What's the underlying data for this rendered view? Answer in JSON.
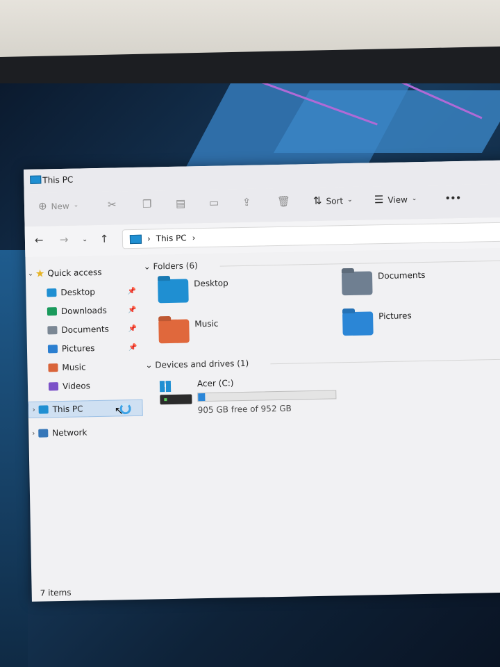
{
  "window": {
    "title": "This PC"
  },
  "toolbar": {
    "new_label": "New",
    "sort_label": "Sort",
    "view_label": "View",
    "more_label": "•••"
  },
  "address": {
    "crumb": "This PC"
  },
  "sidebar": {
    "quick_access": "Quick access",
    "items": [
      {
        "label": "Desktop",
        "color": "#1f8fd2",
        "pinned": true
      },
      {
        "label": "Downloads",
        "color": "#1a9a5c",
        "pinned": true
      },
      {
        "label": "Documents",
        "color": "#7b8794",
        "pinned": true
      },
      {
        "label": "Pictures",
        "color": "#2b7fd0",
        "pinned": true
      },
      {
        "label": "Music",
        "color": "#d9643a",
        "pinned": false
      },
      {
        "label": "Videos",
        "color": "#7c52c8",
        "pinned": false
      }
    ],
    "this_pc": "This PC",
    "network": "Network"
  },
  "content": {
    "folders_header": "Folders (6)",
    "folders": [
      {
        "label": "Desktop",
        "color": "#1f8fd2"
      },
      {
        "label": "Documents",
        "color": "#6f7f91"
      },
      {
        "label": "Music",
        "color": "#e0683c"
      },
      {
        "label": "Pictures",
        "color": "#2b86d6"
      }
    ],
    "devices_header": "Devices and drives (1)",
    "drive": {
      "name": "Acer (C:)",
      "free_text": "905 GB free of 952 GB",
      "used_fraction": 0.05
    }
  },
  "status": {
    "items": "7 items"
  }
}
